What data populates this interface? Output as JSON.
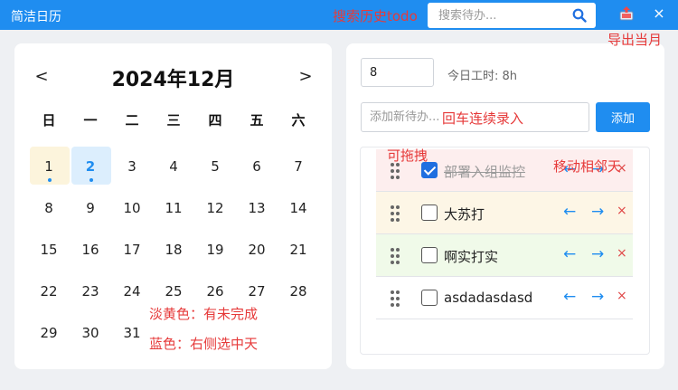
{
  "app": {
    "title": "简洁日历"
  },
  "search": {
    "placeholder": "搜索待办..."
  },
  "window": {
    "close_glyph": "×"
  },
  "calendar": {
    "prev": "<",
    "next": ">",
    "title": "2024年12月",
    "weekdays": [
      "日",
      "一",
      "二",
      "三",
      "四",
      "五",
      "六"
    ],
    "days": [
      "1",
      "2",
      "3",
      "4",
      "5",
      "6",
      "7",
      "8",
      "9",
      "10",
      "11",
      "12",
      "13",
      "14",
      "15",
      "16",
      "17",
      "18",
      "19",
      "20",
      "21",
      "22",
      "23",
      "24",
      "25",
      "26",
      "27",
      "28",
      "29",
      "30",
      "31"
    ],
    "pending_day": "1",
    "selected_day": "2"
  },
  "todo": {
    "hours_value": "8",
    "hours_label": "今日工时: 8h",
    "new_placeholder": "添加新待办...",
    "add_label": "添加",
    "items": [
      {
        "text": "部署入组监控",
        "done": true,
        "color": "#fdeeee"
      },
      {
        "text": "大苏打",
        "done": false,
        "color": "#fdf6e6"
      },
      {
        "text": "啊实打实",
        "done": false,
        "color": "#f0fae9"
      },
      {
        "text": "asdadasdasd",
        "done": false,
        "color": "#ffffff"
      }
    ],
    "arrow_left": "←",
    "arrow_right": "→",
    "delete": "×"
  },
  "annotations": {
    "search_history": "搜索历史todo",
    "export_month": "导出当月",
    "enter_continuous": "回车连续录入",
    "draggable": "可拖拽",
    "move_adjacent": "移动相邻天",
    "light_yellow": "淡黄色：有未完成",
    "blue": "蓝色：右侧选中天"
  },
  "colors": {
    "accent": "#1f8df0",
    "annotation": "#e63a3a"
  }
}
